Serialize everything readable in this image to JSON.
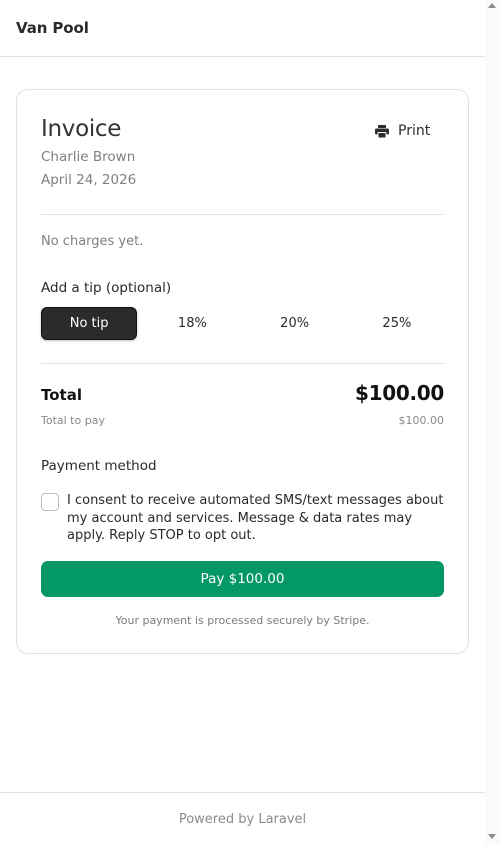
{
  "header": {
    "brand": "Van Pool"
  },
  "invoice": {
    "title": "Invoice",
    "print_label": "Print",
    "customer": "Charlie Brown",
    "date": "April 24, 2026",
    "no_charges": "No charges yet.",
    "tip_heading": "Add a tip (optional)",
    "tips": [
      {
        "label": "No tip",
        "selected": true
      },
      {
        "label": "18%",
        "selected": false
      },
      {
        "label": "20%",
        "selected": false
      },
      {
        "label": "25%",
        "selected": false
      }
    ],
    "total_label": "Total",
    "total_value": "$100.00",
    "total_to_pay_label": "Total to pay",
    "total_to_pay_value": "$100.00",
    "payment_method_heading": "Payment method",
    "consent_text": "I consent to receive automated SMS/text messages about my account and services. Message & data rates may apply. Reply STOP to opt out.",
    "consent_checked": false,
    "pay_button": "Pay $100.00",
    "secure_note": "Your payment is processed securely by Stripe."
  },
  "footer": {
    "text": "Powered by Laravel"
  },
  "colors": {
    "pay_button": "#039865",
    "selected_tip": "#2b2b2b"
  },
  "icons": {
    "print": "printer-icon"
  }
}
